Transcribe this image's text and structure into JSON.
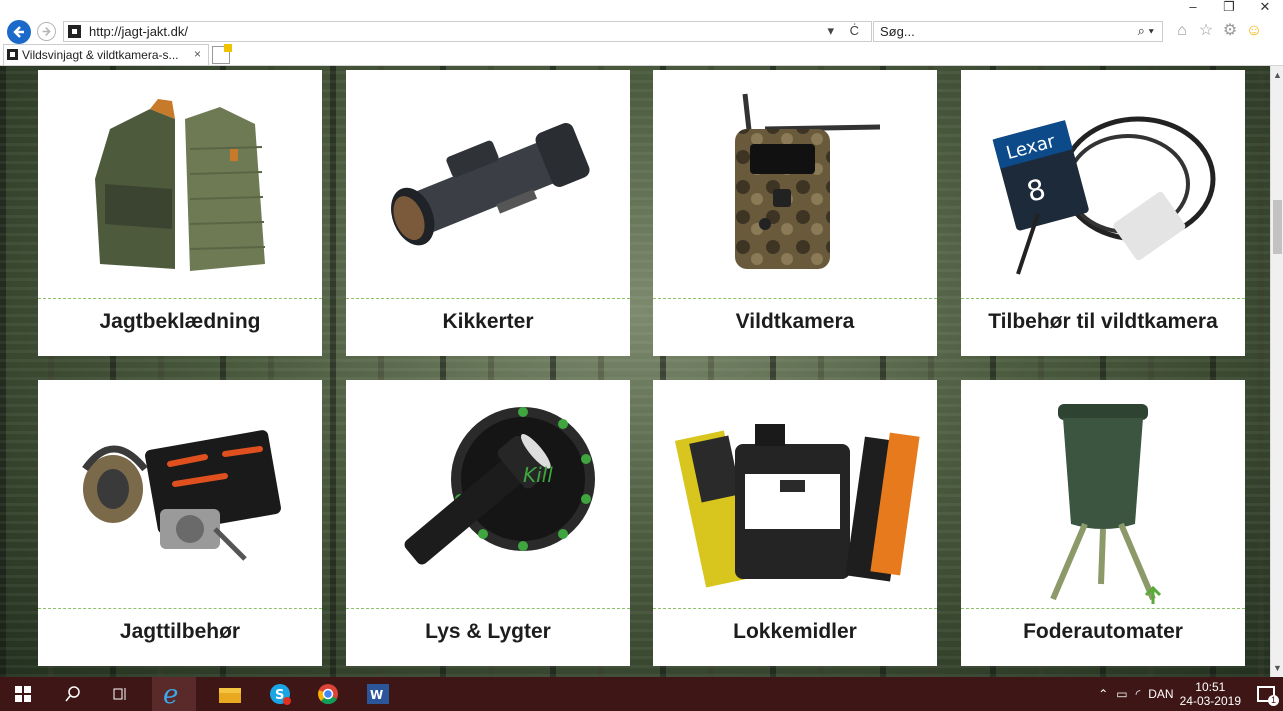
{
  "window": {
    "controls": [
      "–",
      "❐",
      "✕"
    ]
  },
  "address_bar": {
    "url": "http://jagt-jakt.dk/",
    "tools": "▾ Ċ"
  },
  "search_bar": {
    "placeholder": "Søg...",
    "icon_text": "⌕ ▾"
  },
  "toolbar_icons": [
    "home-icon",
    "star-icon",
    "gear-icon",
    "smiley-icon"
  ],
  "tab": {
    "title": "Vildsvinjagt & vildtkamera-s...",
    "close": "×"
  },
  "categories": [
    {
      "label": "Jagtbeklædning",
      "icon": "jacket-icon"
    },
    {
      "label": "Kikkerter",
      "icon": "scope-icon"
    },
    {
      "label": "Vildtkamera",
      "icon": "trail-camera-icon"
    },
    {
      "label": "Tilbehør til vildtkamera",
      "icon": "sd-card-cable-icon"
    },
    {
      "label": "Jagttilbehør",
      "icon": "hunting-kit-icon"
    },
    {
      "label": "Lys & Lygter",
      "icon": "flashlight-icon"
    },
    {
      "label": "Lokkemidler",
      "icon": "lure-products-icon"
    },
    {
      "label": "Foderautomater",
      "icon": "feeder-icon"
    }
  ],
  "taskbar": {
    "apps": [
      "windows-start-icon",
      "search-icon",
      "task-view-icon",
      "internet-explorer-icon",
      "file-explorer-icon",
      "skype-icon",
      "chrome-icon",
      "word-icon"
    ],
    "tray": {
      "language": "DAN",
      "time": "10:51",
      "date": "24-03-2019",
      "notifications": "1"
    }
  },
  "colors": {
    "ie_blue": "#1b6ac9",
    "taskbar": "#3e1616",
    "separator_green": "#8fc06a"
  }
}
